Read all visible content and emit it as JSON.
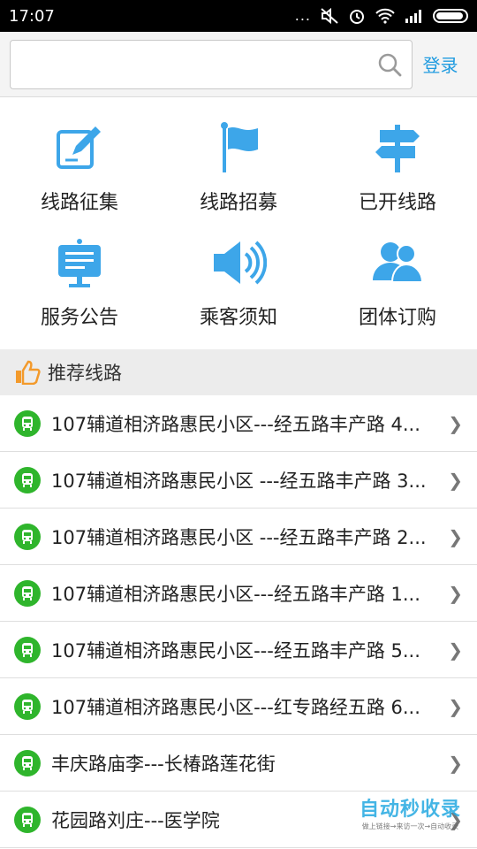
{
  "status_bar": {
    "time": "17:07",
    "dots": "..."
  },
  "search": {
    "value": "",
    "placeholder": "",
    "login_label": "登录"
  },
  "menu": [
    {
      "label": "线路征集",
      "icon": "edit-note-icon"
    },
    {
      "label": "线路招募",
      "icon": "flag-icon"
    },
    {
      "label": "已开线路",
      "icon": "signpost-icon"
    },
    {
      "label": "服务公告",
      "icon": "notice-board-icon"
    },
    {
      "label": "乘客须知",
      "icon": "speaker-icon"
    },
    {
      "label": "团体订购",
      "icon": "group-users-icon"
    }
  ],
  "section": {
    "title": "推荐线路",
    "icon": "thumbs-up-icon"
  },
  "routes": [
    "107辅道相济路惠民小区---经五路丰产路 4...",
    "107辅道相济路惠民小区  ---经五路丰产路 3...",
    "107辅道相济路惠民小区 ---经五路丰产路 2...",
    "107辅道相济路惠民小区---经五路丰产路 1...",
    "107辅道相济路惠民小区---经五路丰产路 5...",
    "107辅道相济路惠民小区---红专路经五路 6...",
    "丰庆路庙李---长椿路莲花街",
    "花园路刘庄---医学院"
  ],
  "watermark": {
    "title": "自动秒收录",
    "subtitle": "做上链接→来访一次→自动收录"
  },
  "colors": {
    "accent": "#1f9be0",
    "icon_blue": "#3da6e9",
    "bus_green": "#2fb52c",
    "thumb_orange": "#f39a2b"
  }
}
